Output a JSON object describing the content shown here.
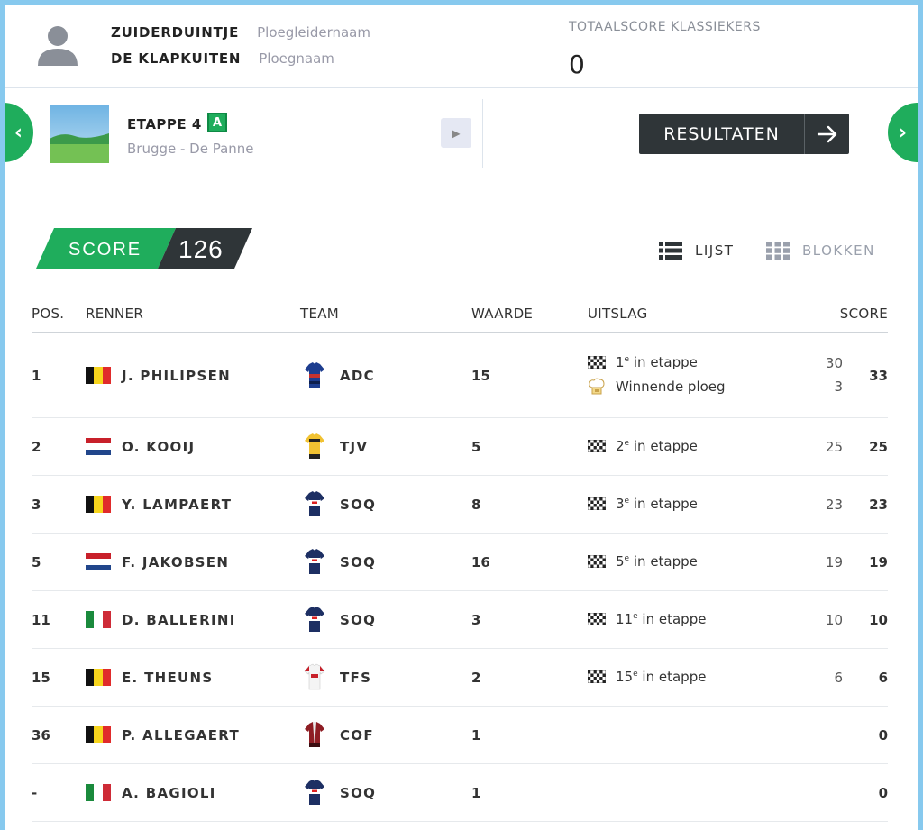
{
  "header": {
    "manager_name": "ZUIDERDUINTJE",
    "manager_label": "Ploegleidernaam",
    "team_name": "DE KLAPKUITEN",
    "team_label": "Ploegnaam",
    "total_label": "TOTAALSCORE KLASSIEKERS",
    "total_value": "0"
  },
  "stage": {
    "title": "ETAPPE 4",
    "badge": "A",
    "route": "Brugge - De Panne",
    "results_button": "RESULTATEN"
  },
  "score": {
    "label": "SCORE",
    "value": "126"
  },
  "view": {
    "list_label": "LIJST",
    "blocks_label": "BLOKKEN"
  },
  "table": {
    "headers": {
      "pos": "POS.",
      "rider": "RENNER",
      "team": "TEAM",
      "value": "WAARDE",
      "result": "UITSLAG",
      "score": "SCORE"
    },
    "rows": [
      {
        "pos": "1",
        "flag": "be",
        "rider": "J. PHILIPSEN",
        "team": "ADC",
        "jersey": "adc",
        "value": "15",
        "results": [
          {
            "icon": "checkered-flag-icon",
            "rank": "1",
            "suffix": "e",
            "text": "in etappe",
            "pts": "30"
          },
          {
            "icon": "chef-hat-icon",
            "rank": "",
            "suffix": "",
            "text": "Winnende ploeg",
            "pts": "3"
          }
        ],
        "total": "33"
      },
      {
        "pos": "2",
        "flag": "nl",
        "rider": "O. KOOIJ",
        "team": "TJV",
        "jersey": "tjv",
        "value": "5",
        "results": [
          {
            "icon": "checkered-flag-icon",
            "rank": "2",
            "suffix": "e",
            "text": "in etappe",
            "pts": "25"
          }
        ],
        "total": "25"
      },
      {
        "pos": "3",
        "flag": "be",
        "rider": "Y. LAMPAERT",
        "team": "SOQ",
        "jersey": "soq",
        "value": "8",
        "results": [
          {
            "icon": "checkered-flag-icon",
            "rank": "3",
            "suffix": "e",
            "text": "in etappe",
            "pts": "23"
          }
        ],
        "total": "23"
      },
      {
        "pos": "5",
        "flag": "nl",
        "rider": "F. JAKOBSEN",
        "team": "SOQ",
        "jersey": "soq",
        "value": "16",
        "results": [
          {
            "icon": "checkered-flag-icon",
            "rank": "5",
            "suffix": "e",
            "text": "in etappe",
            "pts": "19"
          }
        ],
        "total": "19"
      },
      {
        "pos": "11",
        "flag": "it",
        "rider": "D. BALLERINI",
        "team": "SOQ",
        "jersey": "soq",
        "value": "3",
        "results": [
          {
            "icon": "checkered-flag-icon",
            "rank": "11",
            "suffix": "e",
            "text": "in etappe",
            "pts": "10"
          }
        ],
        "total": "10"
      },
      {
        "pos": "15",
        "flag": "be",
        "rider": "E. THEUNS",
        "team": "TFS",
        "jersey": "tfs",
        "value": "2",
        "results": [
          {
            "icon": "checkered-flag-icon",
            "rank": "15",
            "suffix": "e",
            "text": "in etappe",
            "pts": "6"
          }
        ],
        "total": "6"
      },
      {
        "pos": "36",
        "flag": "be",
        "rider": "P. ALLEGAERT",
        "team": "COF",
        "jersey": "cof",
        "value": "1",
        "results": [],
        "total": "0"
      },
      {
        "pos": "-",
        "flag": "it",
        "rider": "A. BAGIOLI",
        "team": "SOQ",
        "jersey": "soq",
        "value": "1",
        "results": [],
        "total": "0"
      }
    ]
  },
  "colors": {
    "accent": "#1fad5c",
    "dark": "#2f3538",
    "frame": "#87c9ee"
  }
}
